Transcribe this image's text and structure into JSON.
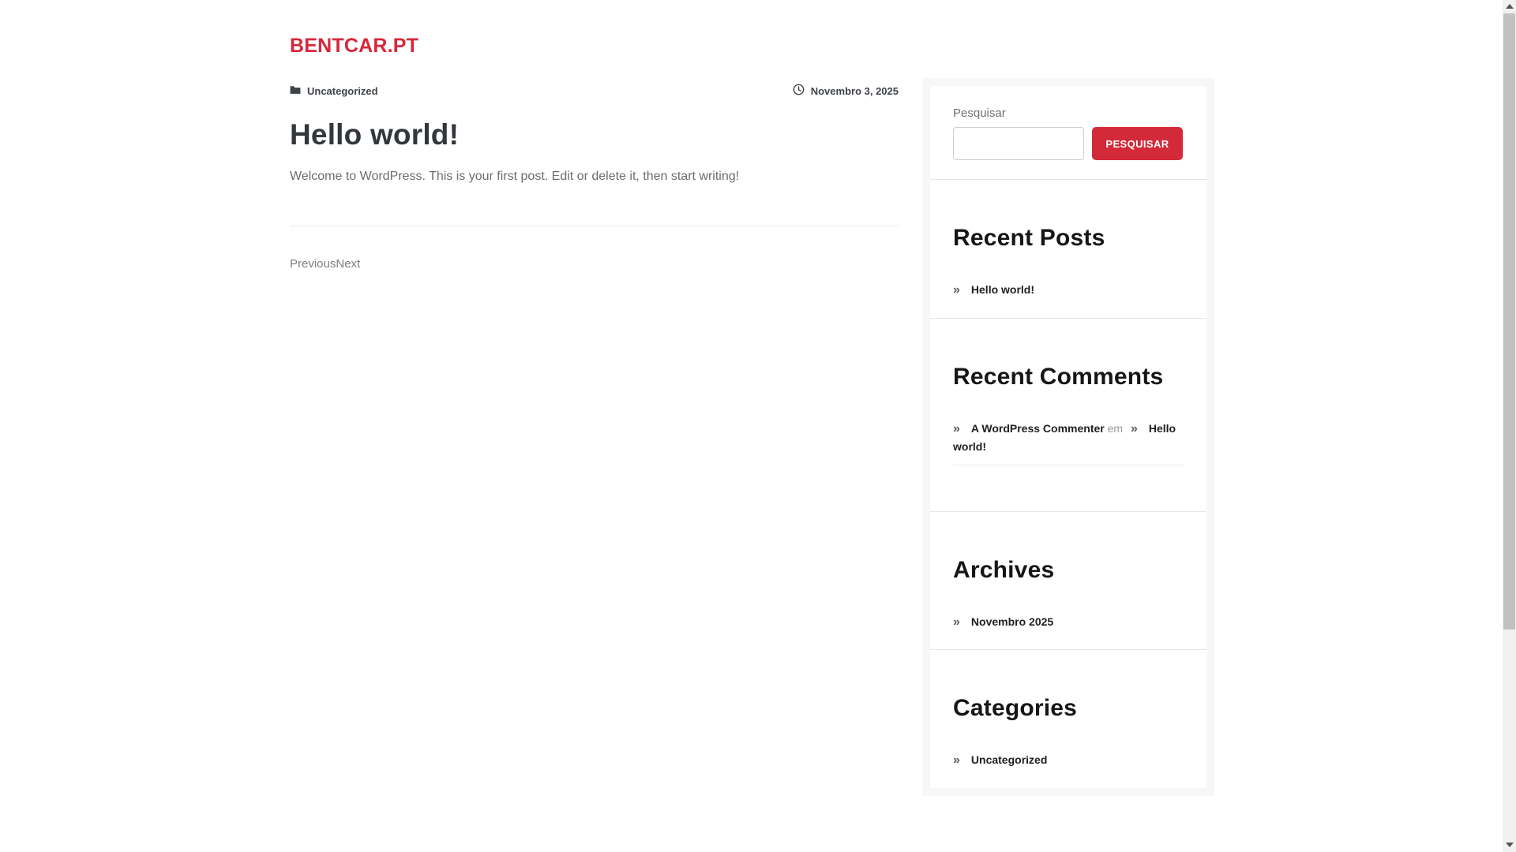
{
  "site": {
    "title": "BENTCAR.PT"
  },
  "post": {
    "category": "Uncategorized",
    "date": "Novembro 3, 2025",
    "title": "Hello world!",
    "body": "Welcome to WordPress. This is your first post. Edit or delete it, then start writing!",
    "previous_label": "Previous",
    "next_label": "Next"
  },
  "sidebar": {
    "search": {
      "label": "Pesquisar",
      "value": "",
      "button_label": "PESQUISAR"
    },
    "recent_posts": {
      "title": "Recent Posts",
      "items": [
        {
          "label": "Hello world!"
        }
      ]
    },
    "recent_comments": {
      "title": "Recent Comments",
      "author": "A WordPress Commenter",
      "connector": "em",
      "post_title": "Hello world!"
    },
    "archives": {
      "title": "Archives",
      "items": [
        {
          "label": "Novembro 2025"
        }
      ]
    },
    "categories": {
      "title": "Categories",
      "items": [
        {
          "label": "Uncategorized"
        }
      ]
    }
  },
  "glyphs": {
    "double_chevron": "»"
  },
  "colors": {
    "accent_red": "#d32a3a",
    "title_red": "#d8273a",
    "post_heading": "#32373c",
    "sidebar_bg": "#f7f7f7",
    "body_text": "#6d6d6d"
  }
}
